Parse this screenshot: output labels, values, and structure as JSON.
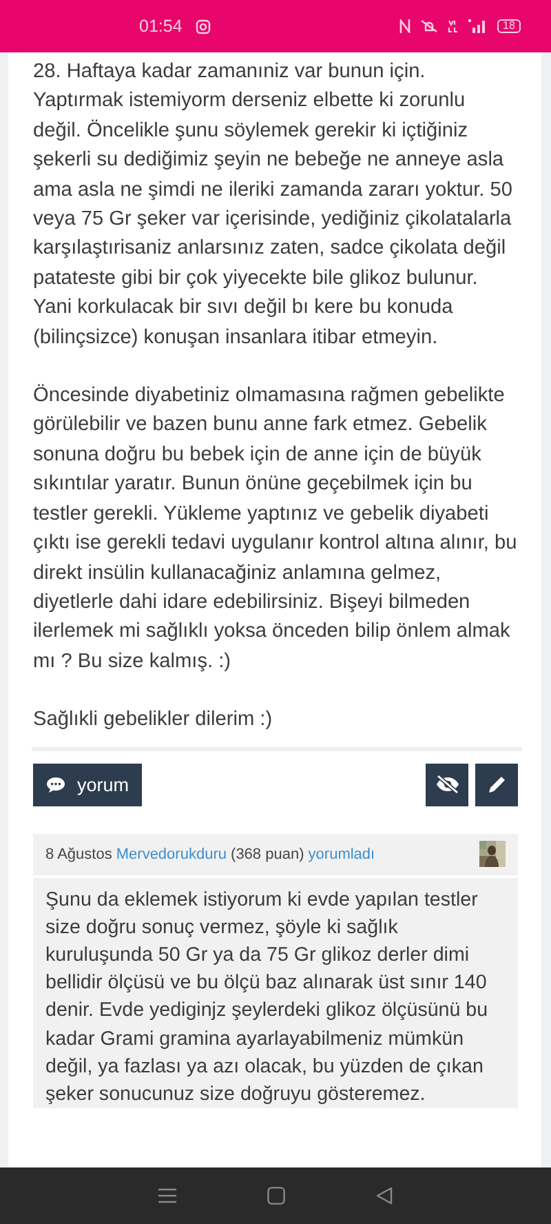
{
  "status_bar": {
    "time": "01:54",
    "battery": "18"
  },
  "post": {
    "paragraphs": [
      "28. Haftaya kadar zamanıniz var bunun için. Yaptırmak istemiyorm derseniz elbette ki zorunlu değil. Öncelikle şunu söylemek gerekir ki içtiğiniz şekerli su dediğimiz şeyin ne bebeğe ne anneye asla ama asla ne şimdi ne ileriki zamanda zararı yoktur. 50 veya 75 Gr şeker var içerisinde, yediğiniz çikolatalarla karşılaştırisaniz anlarsınız zaten, sadce çikolata değil patateste gibi bir çok yiyecekte bile glikoz bulunur. Yani korkulacak bir sıvı değil bı kere bu konuda (bilinçsizce) konuşan insanlara itibar etmeyin.",
      "Öncesinde diyabetiniz olmamasına rağmen gebelikte görülebilir ve bazen bunu anne fark etmez. Gebelik sonuna doğru bu bebek için de anne için de büyük sıkıntılar yaratır. Bunun önüne geçebilmek için bu testler gerekli. Yükleme yaptınız ve gebelik diyabeti çıktı ise gerekli tedavi uygulanır kontrol altına alınır, bu direkt insülin kullanacağiniz anlamına gelmez, diyetlerle dahi idare edebilirsiniz. Bişeyi bilmeden ilerlemek mi sağlıklı yoksa önceden bilip önlem almak mı ? Bu size kalmış.  :)",
      "Sağlıkli gebelikler dilerim :)"
    ]
  },
  "actions": {
    "comment_button": "yorum"
  },
  "comment": {
    "date": "8 Ağustos",
    "author": "Mervedorukduru",
    "points": "(368 puan)",
    "action": "yorumladı",
    "text": "Şunu da eklemek istiyorum ki evde yapılan testler size doğru sonuç vermez, şöyle ki sağlık kuruluşunda 50 Gr ya da 75 Gr glikoz derler dimi bellidir ölçüsü ve bu ölçü baz alınarak üst sınır 140 denir. Evde yediginjz şeylerdeki glikoz ölçüsünü bu kadar Grami gramina ayarlayabilmeniz mümkün değil,  ya fazlası ya azı olacak, bu yüzden de çıkan şeker sonucunuz size doğruyu gösteremez."
  }
}
